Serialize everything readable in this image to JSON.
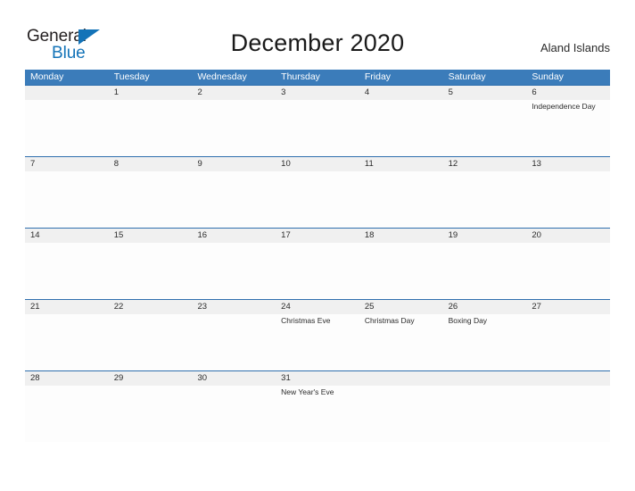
{
  "brand": {
    "name_part1": "General",
    "name_part2": "Blue",
    "triangle_color": "#1373b8"
  },
  "header": {
    "title": "December 2020",
    "region": "Aland Islands"
  },
  "colors": {
    "header_blue": "#3b7cba",
    "row_line_blue": "#2f6fae",
    "date_band_gray": "#f0f0f0",
    "text_dark": "#2b2b2b"
  },
  "calendar": {
    "weekdays": [
      "Monday",
      "Tuesday",
      "Wednesday",
      "Thursday",
      "Friday",
      "Saturday",
      "Sunday"
    ],
    "weeks": [
      [
        {
          "day": "",
          "events": []
        },
        {
          "day": "1",
          "events": []
        },
        {
          "day": "2",
          "events": []
        },
        {
          "day": "3",
          "events": []
        },
        {
          "day": "4",
          "events": []
        },
        {
          "day": "5",
          "events": []
        },
        {
          "day": "6",
          "events": [
            "Independence Day"
          ]
        }
      ],
      [
        {
          "day": "7",
          "events": []
        },
        {
          "day": "8",
          "events": []
        },
        {
          "day": "9",
          "events": []
        },
        {
          "day": "10",
          "events": []
        },
        {
          "day": "11",
          "events": []
        },
        {
          "day": "12",
          "events": []
        },
        {
          "day": "13",
          "events": []
        }
      ],
      [
        {
          "day": "14",
          "events": []
        },
        {
          "day": "15",
          "events": []
        },
        {
          "day": "16",
          "events": []
        },
        {
          "day": "17",
          "events": []
        },
        {
          "day": "18",
          "events": []
        },
        {
          "day": "19",
          "events": []
        },
        {
          "day": "20",
          "events": []
        }
      ],
      [
        {
          "day": "21",
          "events": []
        },
        {
          "day": "22",
          "events": []
        },
        {
          "day": "23",
          "events": []
        },
        {
          "day": "24",
          "events": [
            "Christmas Eve"
          ]
        },
        {
          "day": "25",
          "events": [
            "Christmas Day"
          ]
        },
        {
          "day": "26",
          "events": [
            "Boxing Day"
          ]
        },
        {
          "day": "27",
          "events": []
        }
      ],
      [
        {
          "day": "28",
          "events": []
        },
        {
          "day": "29",
          "events": []
        },
        {
          "day": "30",
          "events": []
        },
        {
          "day": "31",
          "events": [
            "New Year's Eve"
          ]
        },
        {
          "day": "",
          "events": []
        },
        {
          "day": "",
          "events": []
        },
        {
          "day": "",
          "events": []
        }
      ]
    ]
  }
}
